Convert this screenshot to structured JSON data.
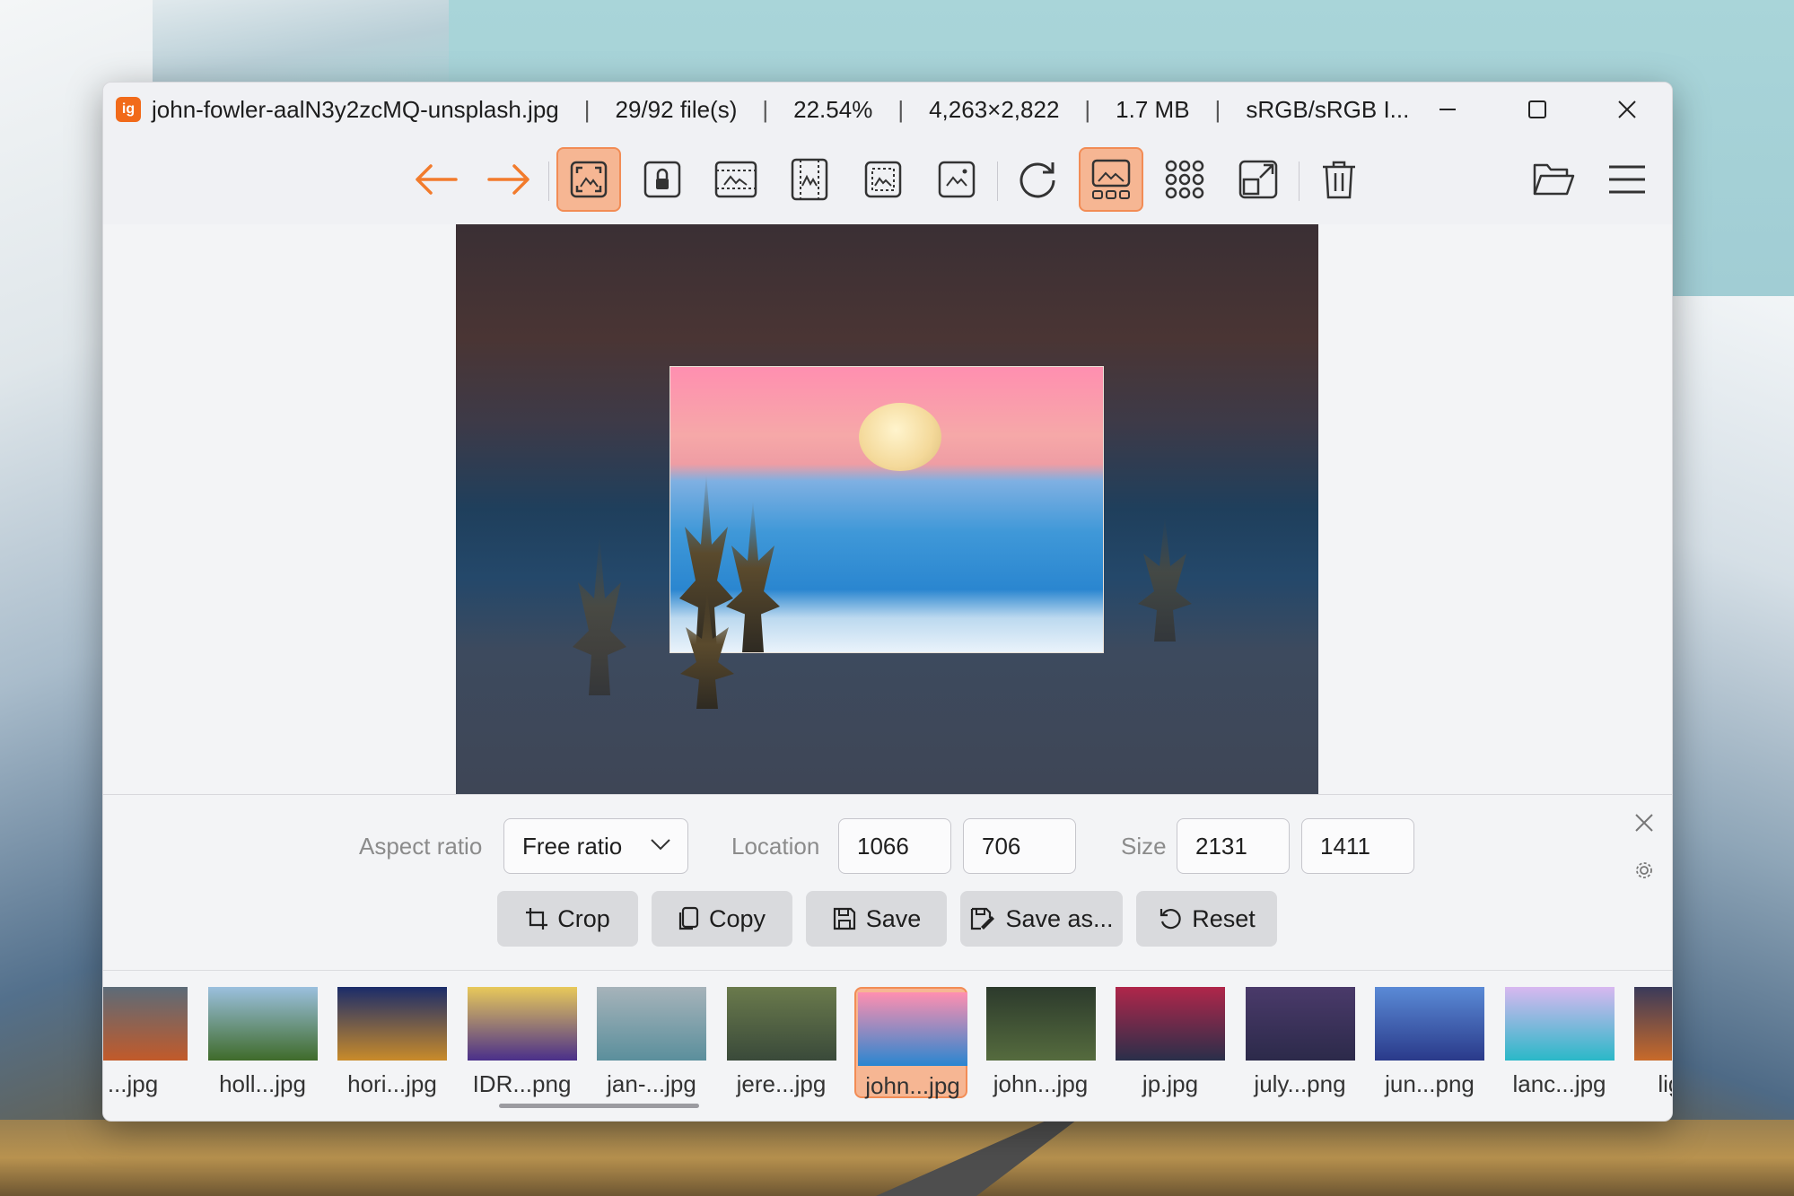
{
  "window": {
    "app_logo": "ig",
    "filename": "john-fowler-aalN3y2zcMQ-unsplash.jpg",
    "file_index": "29/92 file(s)",
    "zoom": "22.54%",
    "dimensions": "4,263×2,822",
    "filesize": "1.7 MB",
    "color_profile": "sRGB/sRGB I...",
    "separator": "|"
  },
  "toolbar": {
    "items": [
      {
        "icon": "arrow-left-icon",
        "label": "Previous"
      },
      {
        "icon": "arrow-right-icon",
        "label": "Next"
      },
      {
        "icon": "auto-zoom-icon",
        "active": true
      },
      {
        "icon": "lock-zoom-icon"
      },
      {
        "icon": "scale-to-width-icon"
      },
      {
        "icon": "scale-to-height-icon"
      },
      {
        "icon": "scale-to-fit-icon"
      },
      {
        "icon": "original-size-icon"
      },
      {
        "icon": "rotate-icon"
      },
      {
        "icon": "gallery-view-icon",
        "active": true
      },
      {
        "icon": "grid-view-icon"
      },
      {
        "icon": "fullscreen-icon"
      },
      {
        "icon": "trash-icon"
      },
      {
        "icon": "open-folder-icon"
      },
      {
        "icon": "menu-icon"
      }
    ],
    "accent": "#f28c55",
    "active_bg": "#f6b693"
  },
  "crop": {
    "aspect_label": "Aspect ratio",
    "aspect_value": "Free ratio",
    "location_label": "Location",
    "location_x": "1066",
    "location_y": "706",
    "size_label": "Size",
    "size_w": "2131",
    "size_h": "1411",
    "buttons": {
      "crop": "Crop",
      "copy": "Copy",
      "save": "Save",
      "save_as": "Save as...",
      "reset": "Reset"
    }
  },
  "gallery": {
    "thumbs": [
      {
        "caption": "...jpg",
        "colors": [
          "#5c6b78",
          "#c25a2a"
        ]
      },
      {
        "caption": "holl...jpg",
        "colors": [
          "#9bc0de",
          "#3f6b2a"
        ]
      },
      {
        "caption": "hori...jpg",
        "colors": [
          "#1b2c6a",
          "#c98b2a"
        ]
      },
      {
        "caption": "IDR...png",
        "colors": [
          "#e8c95a",
          "#4a2f8a"
        ]
      },
      {
        "caption": "jan-...jpg",
        "colors": [
          "#a6b3ba",
          "#5b8f9c"
        ]
      },
      {
        "caption": "jere...jpg",
        "colors": [
          "#6a7a4c",
          "#3a4a3a"
        ]
      },
      {
        "caption": "john...jpg",
        "colors": [
          "#ff8fb0",
          "#2a86d0"
        ],
        "active": true
      },
      {
        "caption": "john...jpg",
        "colors": [
          "#2c3a2c",
          "#556b3e"
        ]
      },
      {
        "caption": "jp.jpg",
        "colors": [
          "#b0264a",
          "#2a2f4a"
        ]
      },
      {
        "caption": "july...png",
        "colors": [
          "#4a3a6a",
          "#2c2a4a"
        ]
      },
      {
        "caption": "jun...png",
        "colors": [
          "#5a8ad6",
          "#2a3a8a"
        ]
      },
      {
        "caption": "lanc...jpg",
        "colors": [
          "#d8b8f0",
          "#2ab8c8"
        ]
      },
      {
        "caption": "light...",
        "colors": [
          "#3a3a5a",
          "#c86a2a"
        ]
      }
    ]
  }
}
